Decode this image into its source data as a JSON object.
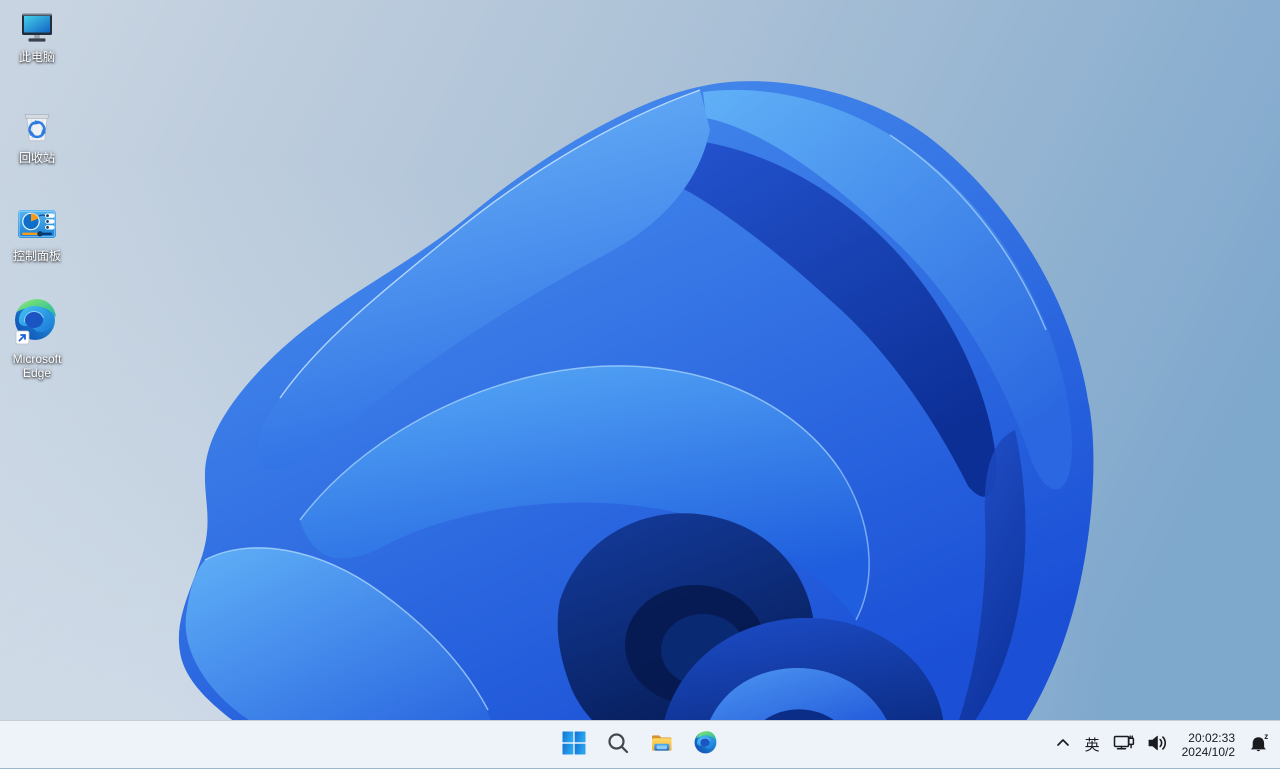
{
  "desktop": {
    "icons": [
      {
        "id": "this-pc",
        "label": "此电脑",
        "icon": "this-pc-icon"
      },
      {
        "id": "recycle-bin",
        "label": "回收站",
        "icon": "recycle-bin-icon"
      },
      {
        "id": "control-panel",
        "label": "控制面板",
        "icon": "control-panel-icon"
      },
      {
        "id": "microsoft-edge",
        "label": "Microsoft Edge",
        "icon": "edge-icon"
      }
    ],
    "wallpaper": "windows-11-bloom-blue"
  },
  "taskbar": {
    "buttons": [
      {
        "id": "start",
        "icon": "windows-start-icon"
      },
      {
        "id": "search",
        "icon": "search-icon"
      },
      {
        "id": "file-explorer",
        "icon": "folder-icon"
      },
      {
        "id": "edge",
        "icon": "edge-icon"
      }
    ],
    "tray": {
      "overflow_icon": "chevron-up-icon",
      "ime": "英",
      "network_icon": "network-ethernet-icon",
      "volume_icon": "speaker-icon",
      "clock": {
        "time": "20:02:33",
        "date": "2024/10/2"
      },
      "notifications_icon": "bell-dnd-icon"
    }
  },
  "colors": {
    "taskbar_bg": "#eef2f9",
    "taskbar_border": "#c8cdd5",
    "tray_text": "#191b1f",
    "bloom_light": "#5fb2f6",
    "bloom_mid": "#2a6ae2",
    "bloom_deep": "#0a2b86",
    "desktop_bg_left": "#c8d4e1",
    "desktop_bg_right": "#7fa8cd"
  }
}
